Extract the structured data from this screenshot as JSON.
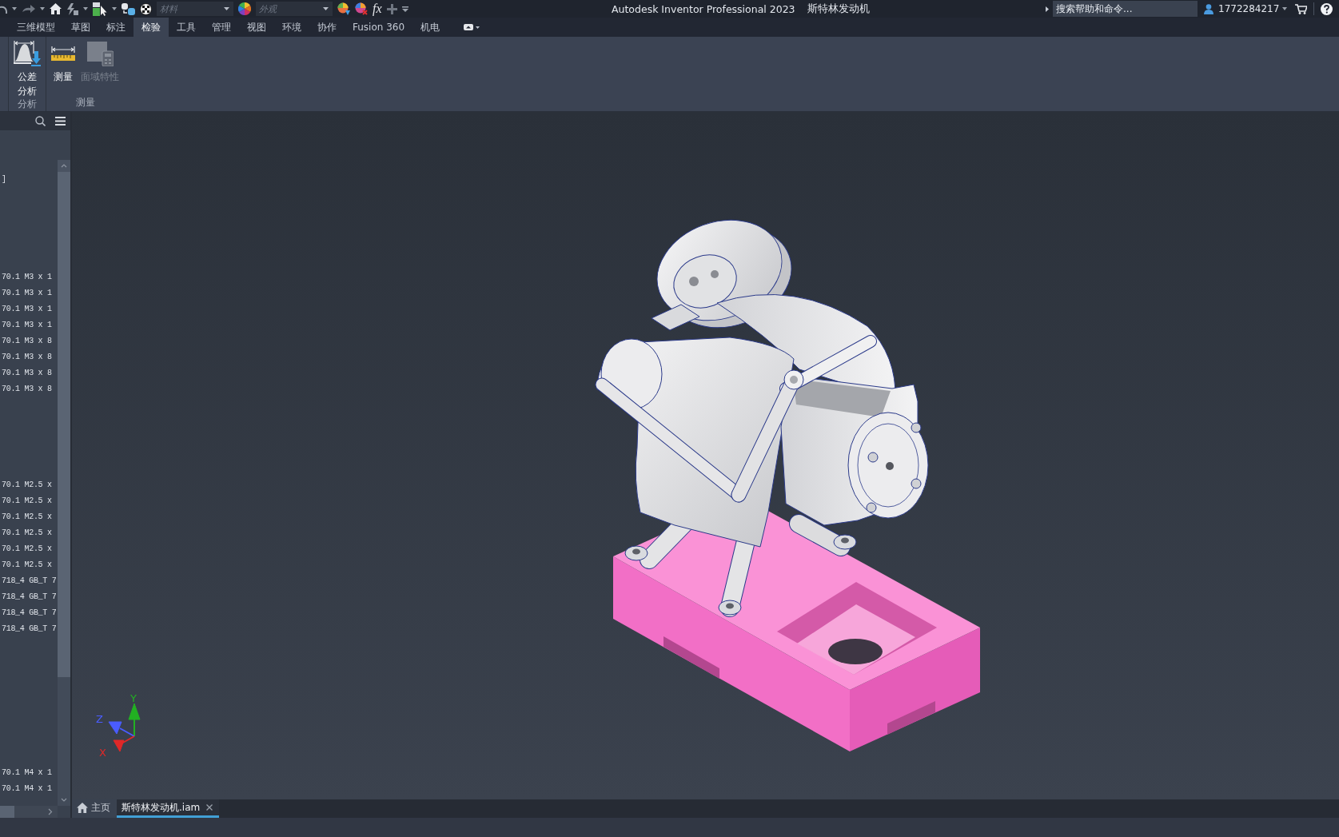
{
  "title_bar": {
    "material_field": {
      "placeholder": "材料"
    },
    "appearance_field": {
      "placeholder": "外观"
    },
    "formula_symbol": "fx",
    "title": "Autodesk Inventor Professional 2023",
    "document": "斯特林发动机",
    "search": {
      "placeholder": "搜索帮助和命令..."
    },
    "user": "1772284217"
  },
  "ribbon_tabs": [
    {
      "label": "三维模型",
      "selected": false
    },
    {
      "label": "草图",
      "selected": false
    },
    {
      "label": "标注",
      "selected": false
    },
    {
      "label": "检验",
      "selected": true
    },
    {
      "label": "工具",
      "selected": false
    },
    {
      "label": "管理",
      "selected": false
    },
    {
      "label": "视图",
      "selected": false
    },
    {
      "label": "环境",
      "selected": false
    },
    {
      "label": "协作",
      "selected": false
    },
    {
      "label": "Fusion 360",
      "selected": false
    },
    {
      "label": "机电",
      "selected": false
    }
  ],
  "ribbon_panels": [
    {
      "label": "分析",
      "buttons": [
        {
          "kind": "tolerance",
          "lines": [
            "公差",
            "分析"
          ],
          "disabled": false
        }
      ]
    },
    {
      "label": "测量",
      "buttons": [
        {
          "kind": "measure",
          "lines": [
            "测量"
          ],
          "disabled": false
        },
        {
          "kind": "region",
          "lines": [
            "面域特性"
          ],
          "disabled": true
        }
      ]
    }
  ],
  "browser": {
    "groups": [
      {
        "rows": [
          "]"
        ]
      },
      {
        "rows": [
          "70.1 M3 x 1",
          "70.1 M3 x 1",
          "70.1 M3 x 1",
          "70.1 M3 x 1",
          "70.1 M3 x 8",
          "70.1 M3 x 8",
          "70.1 M3 x 8",
          "70.1 M3 x 8"
        ]
      },
      {
        "rows": [
          "70.1 M2.5 x",
          "70.1 M2.5 x",
          "70.1 M2.5 x",
          "70.1 M2.5 x",
          "70.1 M2.5 x",
          "70.1 M2.5 x",
          "718_4 GB_T 7",
          "718_4 GB_T 7",
          "718_4 GB_T 7",
          "718_4 GB_T 7"
        ]
      },
      {
        "rows": [
          "70.1 M4 x 1",
          "70.1 M4 x 1"
        ]
      }
    ]
  },
  "view_triad": {
    "axes": [
      {
        "label": "Y",
        "color": "#22b022"
      },
      {
        "label": "Z",
        "color": "#4a5cff"
      },
      {
        "label": "X",
        "color": "#e02828"
      }
    ]
  },
  "document_tabs": [
    {
      "kind": "home",
      "label": "主页",
      "selected": false
    },
    {
      "kind": "file",
      "label": "斯特林发动机.iam",
      "selected": true
    }
  ]
}
